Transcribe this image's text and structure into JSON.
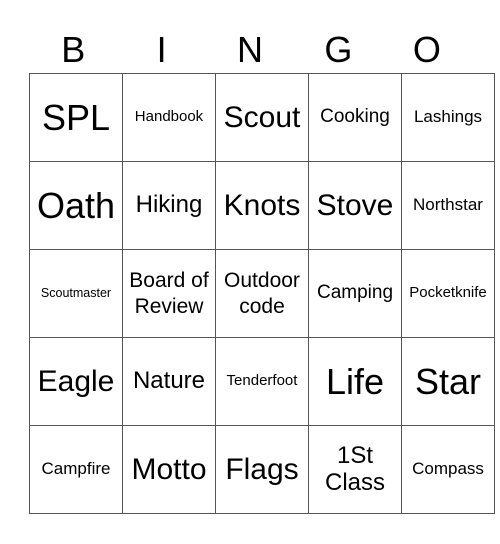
{
  "header": {
    "letters": [
      "B",
      "I",
      "N",
      "G",
      "O"
    ]
  },
  "rows": [
    [
      "SPL",
      "Handbook",
      "Scout",
      "Cooking",
      "Lashings"
    ],
    [
      "Oath",
      "Hiking",
      "Knots",
      "Stove",
      "Northstar"
    ],
    [
      "Scoutmaster",
      "Board of Review",
      "Outdoor code",
      "Camping",
      "Pocketknife"
    ],
    [
      "Eagle",
      "Nature",
      "Tenderfoot",
      "Life",
      "Star"
    ],
    [
      "Campfire",
      "Motto",
      "Flags",
      "1St Class",
      "Compass"
    ]
  ]
}
